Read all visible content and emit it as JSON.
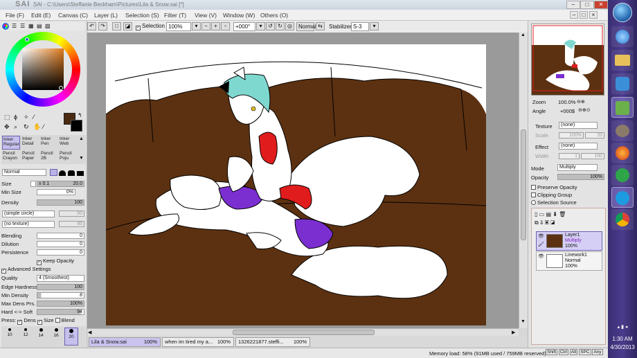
{
  "app": {
    "title": "SAI - C:\\Users\\Steffanie Beckham\\Pictures\\Lila & Snow.sai [*]",
    "logo": "SAI"
  },
  "menu": [
    "File (F)",
    "Edit (E)",
    "Canvas (C)",
    "Layer (L)",
    "Selection (S)",
    "Filter (T)",
    "View (V)",
    "Window (W)",
    "Others (O)"
  ],
  "toolbar": {
    "selection_label": "Selection",
    "zoom": "100%",
    "rotation": "+000°",
    "mode": "Normal",
    "stabilizer_label": "Stabilizer",
    "stabilizer": "S-3"
  },
  "tools": {
    "primary_color": "#4a2a10",
    "tool_buttons": [
      {
        "label": "Inker Regular"
      },
      {
        "label": "Inker Detail"
      },
      {
        "label": "Inker Pen"
      },
      {
        "label": "Inker Web"
      },
      {
        "label": "Pencil Crayon"
      },
      {
        "label": "Pencil Paper"
      },
      {
        "label": "Pencil 2B"
      },
      {
        "label": "Pencil Poju"
      }
    ],
    "blend_mode": "Normal",
    "size_label": "Size",
    "size_mult": "x 0.1",
    "size_value": "20.0",
    "min_size_label": "Min Size",
    "min_size_value": "0%",
    "density_label": "Density",
    "density_value": "100",
    "shape": "(simple circle)",
    "shape_value": "50",
    "texture": "(no texture)",
    "texture_value": "95",
    "blending_label": "Blending",
    "blending_value": "0",
    "dilution_label": "Dilution",
    "dilution_value": "0",
    "persistence_label": "Persistence",
    "persistence_value": "0",
    "keep_opacity_label": "Keep Opacity",
    "advanced_label": "Advanced Settings",
    "quality_label": "Quality",
    "quality_value": "4 (Smoothest)",
    "edge_label": "Edge Hardness",
    "edge_value": "100",
    "min_density_label": "Min Density",
    "min_density_value": "8",
    "max_dens_label": "Max Dens Prs.",
    "max_dens_value": "100%",
    "hard_soft_label": "Hard <-> Soft",
    "hard_soft_value": "94",
    "press_label": "Press:",
    "dens_label": "Dens",
    "size_chk_label": "Size",
    "blend_chk_label": "Blend",
    "brush_sizes": [
      "10",
      "12",
      "14",
      "16",
      "20"
    ]
  },
  "navigator": {
    "zoom_label": "Zoom",
    "zoom_value": "100.0%",
    "angle_label": "Angle",
    "angle_value": "+000$"
  },
  "layer_props": {
    "texture_label": "Texture",
    "texture_value": "(none)",
    "scale_label": "Scale",
    "scale_value": "100%",
    "scale_num": "20",
    "effect_label": "Effect",
    "effect_value": "(none)",
    "width_label": "Width",
    "width_value": "1",
    "width_num": "100",
    "mode_label": "Mode",
    "mode_value": "Multiply",
    "opacity_label": "Opacity",
    "opacity_value": "100%",
    "preserve_label": "Preserve Opacity",
    "clipping_label": "Clipping Group",
    "selsource_label": "Selection Source"
  },
  "layers": [
    {
      "name": "Layer1",
      "mode": "Multiply",
      "opacity": "100%",
      "active": true
    },
    {
      "name": "Linework1",
      "mode": "Normal",
      "opacity": "100%",
      "active": false
    }
  ],
  "doc_tabs": [
    {
      "name": "Lila & Snow.sai",
      "zoom": "100%"
    },
    {
      "name": "when im tired my a...",
      "zoom": "100%"
    },
    {
      "name": "1326221877.steffi...",
      "zoom": "100%"
    }
  ],
  "status": {
    "memory": "Memory load: 58% (91MB used / 759MB reserved)",
    "keys": [
      "Shift",
      "Ctrl",
      "Alt",
      "SPC",
      "Any"
    ]
  },
  "taskbar": {
    "time": "1:30 AM",
    "date": "4/30/2013"
  },
  "colors": {
    "couch_brown": "#5c3111",
    "purple_clothing": "#7b2fd0",
    "red_clothing": "#e01c1c",
    "hair_teal": "#7fd8cf"
  }
}
